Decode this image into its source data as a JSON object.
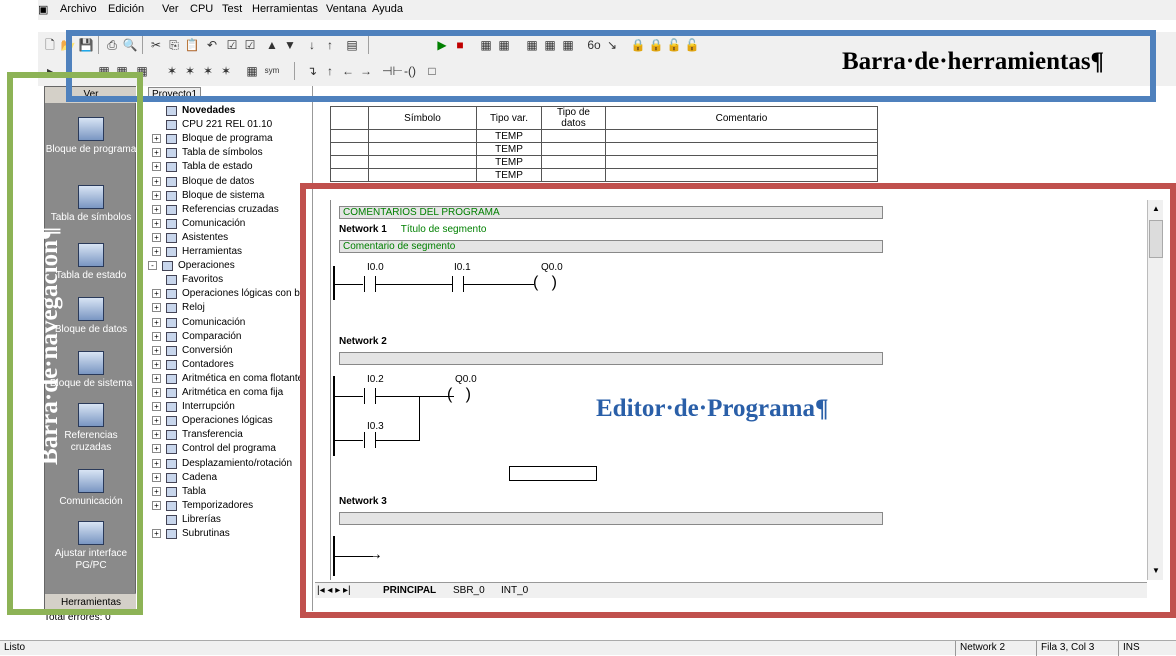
{
  "menubar": {
    "items": [
      "Archivo",
      "Edición",
      "Ver",
      "CPU",
      "Test",
      "Herramientas",
      "Ventana",
      "Ayuda"
    ]
  },
  "navbar": {
    "header": "Ver",
    "items": [
      {
        "label": "Bloque de programa",
        "icon": "program-block-icon"
      },
      {
        "label": "Tabla de símbolos",
        "icon": "symbol-table-icon"
      },
      {
        "label": "Tabla de estado",
        "icon": "status-table-icon"
      },
      {
        "label": "Bloque de datos",
        "icon": "data-block-icon"
      },
      {
        "label": "Bloque de sistema",
        "icon": "system-block-icon"
      },
      {
        "label": "Referencias cruzadas",
        "icon": "cross-ref-icon"
      },
      {
        "label": "Comunicación",
        "icon": "communication-icon"
      },
      {
        "label": "Ajustar interface PG/PC",
        "icon": "pgpc-interface-icon"
      }
    ],
    "footer": "Herramientas"
  },
  "tree": {
    "project": "Proyecto1",
    "items": [
      {
        "label": "Novedades",
        "bold": true,
        "indent": 1
      },
      {
        "label": "CPU 221 REL 01.10",
        "indent": 1
      },
      {
        "label": "Bloque de programa",
        "indent": 1,
        "exp": "+"
      },
      {
        "label": "Tabla de símbolos",
        "indent": 1,
        "exp": "+"
      },
      {
        "label": "Tabla de estado",
        "indent": 1,
        "exp": "+"
      },
      {
        "label": "Bloque de datos",
        "indent": 1,
        "exp": "+"
      },
      {
        "label": "Bloque de sistema",
        "indent": 1,
        "exp": "+"
      },
      {
        "label": "Referencias cruzadas",
        "indent": 1,
        "exp": "+"
      },
      {
        "label": "Comunicación",
        "indent": 1,
        "exp": "+"
      },
      {
        "label": "Asistentes",
        "indent": 1,
        "exp": "+"
      },
      {
        "label": "Herramientas",
        "indent": 1,
        "exp": "+"
      },
      {
        "label": "Operaciones",
        "indent": 0,
        "exp": "-"
      },
      {
        "label": "Favoritos",
        "indent": 1
      },
      {
        "label": "Operaciones lógicas con bit",
        "indent": 1,
        "exp": "+"
      },
      {
        "label": "Reloj",
        "indent": 1,
        "exp": "+"
      },
      {
        "label": "Comunicación",
        "indent": 1,
        "exp": "+"
      },
      {
        "label": "Comparación",
        "indent": 1,
        "exp": "+"
      },
      {
        "label": "Conversión",
        "indent": 1,
        "exp": "+"
      },
      {
        "label": "Contadores",
        "indent": 1,
        "exp": "+"
      },
      {
        "label": "Aritmética en coma flotante",
        "indent": 1,
        "exp": "+"
      },
      {
        "label": "Aritmética en coma fija",
        "indent": 1,
        "exp": "+"
      },
      {
        "label": "Interrupción",
        "indent": 1,
        "exp": "+"
      },
      {
        "label": "Operaciones lógicas",
        "indent": 1,
        "exp": "+"
      },
      {
        "label": "Transferencia",
        "indent": 1,
        "exp": "+"
      },
      {
        "label": "Control del programa",
        "indent": 1,
        "exp": "+"
      },
      {
        "label": "Desplazamiento/rotación",
        "indent": 1,
        "exp": "+"
      },
      {
        "label": "Cadena",
        "indent": 1,
        "exp": "+"
      },
      {
        "label": "Tabla",
        "indent": 1,
        "exp": "+"
      },
      {
        "label": "Temporizadores",
        "indent": 1,
        "exp": "+"
      },
      {
        "label": "Librerías",
        "indent": 1
      },
      {
        "label": "Subrutinas",
        "indent": 1,
        "exp": "+"
      }
    ]
  },
  "symtable": {
    "headers": [
      "Símbolo",
      "Tipo var.",
      "Tipo de datos",
      "Comentario"
    ],
    "rows": [
      "TEMP",
      "TEMP",
      "TEMP",
      "TEMP"
    ]
  },
  "editor": {
    "program_comment": "COMENTARIOS DEL PROGRAMA",
    "network1": {
      "title": "Network 1",
      "subtitle": "Título de segmento",
      "comment": "Comentario de segmento",
      "c1": "I0.0",
      "c2": "I0.1",
      "coil": "Q0.0"
    },
    "network2": {
      "title": "Network 2",
      "c1": "I0.2",
      "c2": "I0.3",
      "coil": "Q0.0"
    },
    "network3": {
      "title": "Network 3"
    }
  },
  "tabs": [
    "PRINCIPAL",
    "SBR_0",
    "INT_0"
  ],
  "errors": "Total errores: 0",
  "status": {
    "left": "Listo",
    "network": "Network 2",
    "pos": "Fila 3, Col 3",
    "mode": "INS"
  },
  "annotations": {
    "toolbar": "Barra·de·herramientas¶",
    "nav": "Barra·de·navegación¶",
    "editor": "Editor·de·Programa¶"
  },
  "colors": {
    "toolbar_box": "#4f81bd",
    "nav_box": "#8db356",
    "editor_box": "#c0504d"
  }
}
